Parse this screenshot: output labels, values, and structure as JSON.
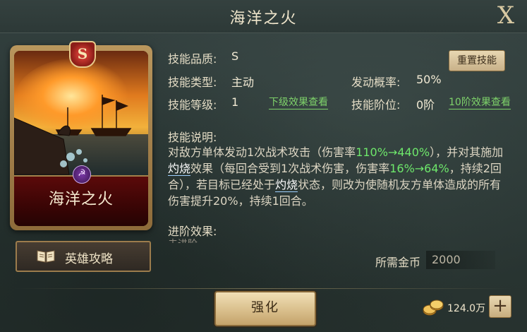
{
  "window": {
    "title": "海洋之火",
    "close_glyph": "X"
  },
  "card": {
    "name": "海洋之火",
    "grade": "S",
    "emblem_icon": "hammer-sickle-emblem-icon",
    "emblem_glyph": "☭"
  },
  "guide_button": {
    "label": "英雄攻略",
    "icon": "book-icon"
  },
  "skill": {
    "quality_label": "技能品质:",
    "quality_value": "S",
    "type_label": "技能类型:",
    "type_value": "主动",
    "prob_label": "发动概率:",
    "prob_value": "50%",
    "level_label": "技能等级:",
    "level_value": "1",
    "lower_link": "下级效果查看",
    "stage_label": "技能阶位:",
    "stage_value": "0阶",
    "stage_link": "10阶效果查看",
    "reset_label": "重置技能"
  },
  "description": {
    "title": "技能说明:",
    "part1": "对敌方单体发动1次战术攻击（伤害率",
    "part2_green": "110%→440%",
    "part3": "），并对其施加",
    "kw1": "灼烧",
    "part4": "效果（每回合受到1次战术伤害，伤害率",
    "part5_green": "16%→64%",
    "part6": "，持续2回合），若目标已经处于",
    "kw2": "灼烧",
    "part7": "状态，则改为使随机友方单体造成的所有伤害提升20%，持续1回合。"
  },
  "advance": {
    "title": "进阶效果:",
    "faded_text": "未进阶"
  },
  "cost": {
    "label": "所需金币",
    "value": "2000"
  },
  "enhance_button": {
    "label": "强化"
  },
  "currency": {
    "amount": "124.0万",
    "icon": "gold-coins-icon",
    "plus_label": "+"
  },
  "colors": {
    "accent_green": "#6ee86b",
    "link_green": "#7ed26a",
    "card_red": "#5b0a0a",
    "gold_border": "#b9965d"
  }
}
